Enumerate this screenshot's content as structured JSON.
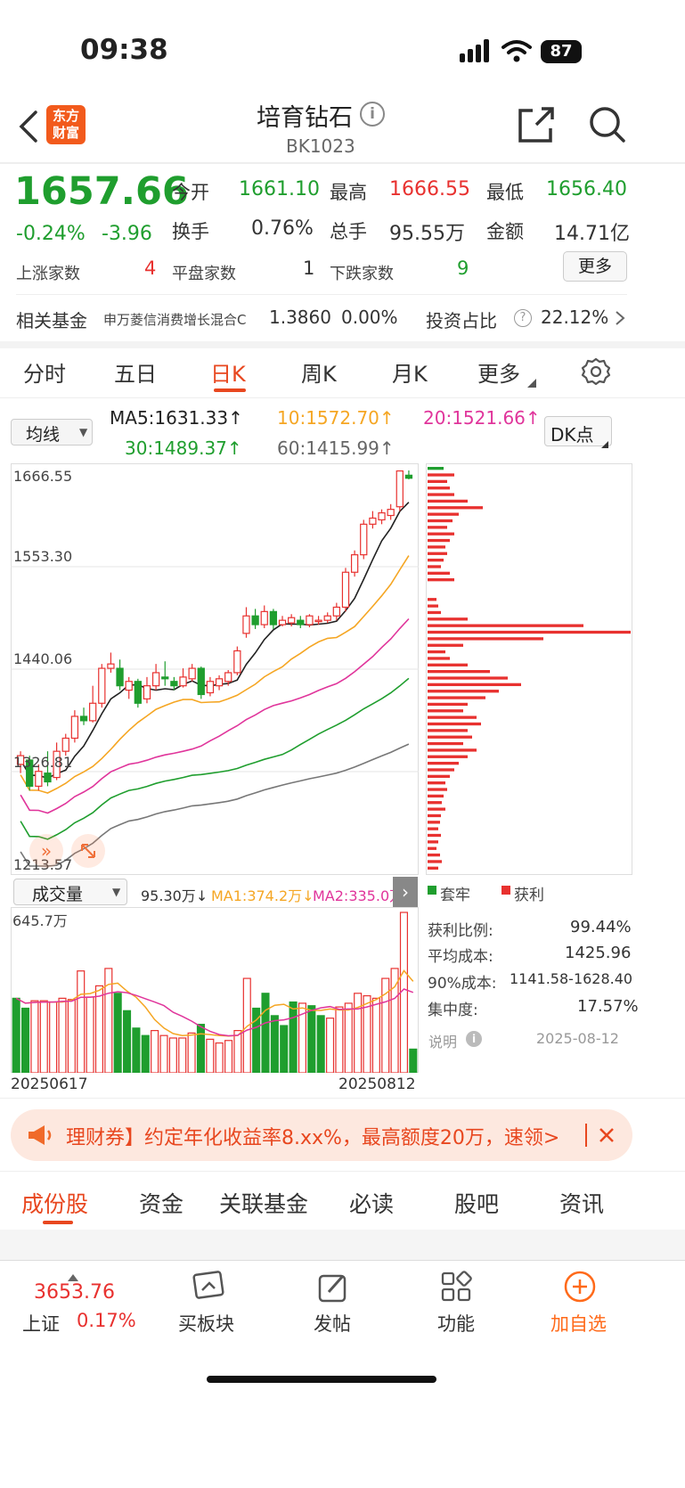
{
  "status": {
    "time": "09:38",
    "battery": "87"
  },
  "header": {
    "logo_line1": "东方",
    "logo_line2": "财富",
    "title": "培育钻石",
    "code": "BK1023"
  },
  "quote": {
    "price": "1657.66",
    "change_pct": "-0.24%",
    "change": "-3.96",
    "open_label": "今开",
    "open": "1661.10",
    "high_label": "最高",
    "high": "1666.55",
    "low_label": "最低",
    "low": "1656.40",
    "turnover_label": "换手",
    "turnover": "0.76%",
    "volume_label": "总手",
    "volume": "95.55万",
    "amount_label": "金额",
    "amount": "14.71亿",
    "up_label": "上涨家数",
    "up": "4",
    "flat_label": "平盘家数",
    "flat": "1",
    "down_label": "下跌家数",
    "down": "9",
    "more": "更多"
  },
  "fund": {
    "label": "相关基金",
    "name": "申万菱信消费增长混合C",
    "nav": "1.3860",
    "pct": "0.00%",
    "ratio_label": "投资占比",
    "ratio": "22.12%"
  },
  "tabs": [
    "分时",
    "五日",
    "日K",
    "周K",
    "月K",
    "更多"
  ],
  "ma": {
    "selector": "均线",
    "ma5": "MA5:1631.33",
    "ma10": "10:1572.70",
    "ma20": "20:1521.66",
    "ma30": "30:1489.37",
    "ma60": "60:1415.99",
    "dk": "DK点"
  },
  "axis": {
    "y1": "1666.55",
    "y2": "1553.30",
    "y3": "1440.06",
    "y4": "1326.81",
    "y5": "1213.57"
  },
  "volume_panel": {
    "selector": "成交量",
    "vol": "95.30万",
    "ma1": "MA1:374.2万",
    "ma2": "MA2:335.0万",
    "max": "645.7万",
    "date_start": "20250617",
    "date_end": "20250812"
  },
  "chip": {
    "legend_solid": "套牢",
    "legend_profit": "获利",
    "profit_ratio_label": "获利比例:",
    "profit_ratio": "99.44%",
    "avg_cost_label": "平均成本:",
    "avg_cost": "1425.96",
    "cost90_label": "90%成本:",
    "cost90": "1141.58-1628.40",
    "concentration_label": "集中度:",
    "concentration": "17.57%",
    "note_label": "说明",
    "date": "2025-08-12"
  },
  "banner": {
    "text": "理财券】约定年化收益率8.xx%，最高额度20万，速领>"
  },
  "bottom_tabs": [
    "成份股",
    "资金",
    "关联基金",
    "必读",
    "股吧",
    "资讯"
  ],
  "toolbar": {
    "index_value": "3653.76",
    "index_name": "上证",
    "index_pct": "0.17%",
    "buy": "买板块",
    "post": "发帖",
    "func": "功能",
    "add": "加自选"
  },
  "colors": {
    "up": "#e8312f",
    "down": "#1f9e2e",
    "ma5": "#222222",
    "ma10": "#f5a623",
    "ma20": "#e0359b",
    "ma30": "#1f9e2e",
    "ma60": "#777777",
    "accent": "#ff6a1a"
  },
  "chart_data": {
    "type": "candlestick",
    "y_range": [
      1213.57,
      1666.55
    ],
    "candles": [
      {
        "o": 1330,
        "c": 1340,
        "h": 1345,
        "l": 1320
      },
      {
        "o": 1335,
        "c": 1305,
        "h": 1340,
        "l": 1300
      },
      {
        "o": 1305,
        "c": 1322,
        "h": 1330,
        "l": 1300
      },
      {
        "o": 1320,
        "c": 1310,
        "h": 1345,
        "l": 1305
      },
      {
        "o": 1315,
        "c": 1345,
        "h": 1355,
        "l": 1312
      },
      {
        "o": 1345,
        "c": 1360,
        "h": 1365,
        "l": 1340
      },
      {
        "o": 1360,
        "c": 1385,
        "h": 1392,
        "l": 1355
      },
      {
        "o": 1385,
        "c": 1380,
        "h": 1395,
        "l": 1375
      },
      {
        "o": 1380,
        "c": 1400,
        "h": 1420,
        "l": 1378
      },
      {
        "o": 1400,
        "c": 1440,
        "h": 1445,
        "l": 1395
      },
      {
        "o": 1440,
        "c": 1445,
        "h": 1458,
        "l": 1435
      },
      {
        "o": 1440,
        "c": 1420,
        "h": 1450,
        "l": 1415
      },
      {
        "o": 1415,
        "c": 1425,
        "h": 1430,
        "l": 1405
      },
      {
        "o": 1425,
        "c": 1400,
        "h": 1428,
        "l": 1395
      },
      {
        "o": 1405,
        "c": 1420,
        "h": 1430,
        "l": 1400
      },
      {
        "o": 1420,
        "c": 1435,
        "h": 1445,
        "l": 1415
      },
      {
        "o": 1430,
        "c": 1428,
        "h": 1448,
        "l": 1420
      },
      {
        "o": 1425,
        "c": 1420,
        "h": 1430,
        "l": 1415
      },
      {
        "o": 1420,
        "c": 1430,
        "h": 1440,
        "l": 1418
      },
      {
        "o": 1428,
        "c": 1440,
        "h": 1445,
        "l": 1425
      },
      {
        "o": 1440,
        "c": 1410,
        "h": 1442,
        "l": 1405
      },
      {
        "o": 1412,
        "c": 1425,
        "h": 1430,
        "l": 1408
      },
      {
        "o": 1420,
        "c": 1428,
        "h": 1432,
        "l": 1415
      },
      {
        "o": 1425,
        "c": 1435,
        "h": 1438,
        "l": 1420
      },
      {
        "o": 1435,
        "c": 1460,
        "h": 1465,
        "l": 1432
      },
      {
        "o": 1480,
        "c": 1500,
        "h": 1510,
        "l": 1475
      },
      {
        "o": 1500,
        "c": 1490,
        "h": 1508,
        "l": 1485
      },
      {
        "o": 1490,
        "c": 1505,
        "h": 1512,
        "l": 1486
      },
      {
        "o": 1505,
        "c": 1490,
        "h": 1508,
        "l": 1485
      },
      {
        "o": 1490,
        "c": 1495,
        "h": 1500,
        "l": 1488
      },
      {
        "o": 1492,
        "c": 1498,
        "h": 1502,
        "l": 1488
      },
      {
        "o": 1495,
        "c": 1490,
        "h": 1500,
        "l": 1486
      },
      {
        "o": 1490,
        "c": 1500,
        "h": 1502,
        "l": 1487
      },
      {
        "o": 1495,
        "c": 1495,
        "h": 1500,
        "l": 1490
      },
      {
        "o": 1495,
        "c": 1500,
        "h": 1504,
        "l": 1492
      },
      {
        "o": 1500,
        "c": 1510,
        "h": 1515,
        "l": 1495
      },
      {
        "o": 1510,
        "c": 1550,
        "h": 1555,
        "l": 1505
      },
      {
        "o": 1550,
        "c": 1570,
        "h": 1575,
        "l": 1545
      },
      {
        "o": 1570,
        "c": 1605,
        "h": 1610,
        "l": 1565
      },
      {
        "o": 1605,
        "c": 1612,
        "h": 1620,
        "l": 1600
      },
      {
        "o": 1610,
        "c": 1618,
        "h": 1622,
        "l": 1605
      },
      {
        "o": 1615,
        "c": 1622,
        "h": 1628,
        "l": 1610
      },
      {
        "o": 1625,
        "c": 1666,
        "h": 1666.55,
        "l": 1620
      },
      {
        "o": 1661.1,
        "c": 1657.66,
        "h": 1666.55,
        "l": 1656.4
      }
    ],
    "volumes": [
      {
        "v": 300,
        "up": false
      },
      {
        "v": 260,
        "up": false
      },
      {
        "v": 290,
        "up": true
      },
      {
        "v": 290,
        "up": true
      },
      {
        "v": 285,
        "up": true
      },
      {
        "v": 300,
        "up": true
      },
      {
        "v": 295,
        "up": true
      },
      {
        "v": 410,
        "up": true
      },
      {
        "v": 305,
        "up": true
      },
      {
        "v": 350,
        "up": true
      },
      {
        "v": 420,
        "up": true
      },
      {
        "v": 320,
        "up": false
      },
      {
        "v": 250,
        "up": false
      },
      {
        "v": 180,
        "up": false
      },
      {
        "v": 150,
        "up": false
      },
      {
        "v": 170,
        "up": true
      },
      {
        "v": 150,
        "up": true
      },
      {
        "v": 140,
        "up": true
      },
      {
        "v": 140,
        "up": true
      },
      {
        "v": 160,
        "up": true
      },
      {
        "v": 195,
        "up": false
      },
      {
        "v": 135,
        "up": true
      },
      {
        "v": 120,
        "up": true
      },
      {
        "v": 130,
        "up": true
      },
      {
        "v": 170,
        "up": true
      },
      {
        "v": 380,
        "up": true
      },
      {
        "v": 260,
        "up": false
      },
      {
        "v": 320,
        "up": false
      },
      {
        "v": 230,
        "up": false
      },
      {
        "v": 190,
        "up": false
      },
      {
        "v": 285,
        "up": false
      },
      {
        "v": 280,
        "up": true
      },
      {
        "v": 270,
        "up": false
      },
      {
        "v": 230,
        "up": false
      },
      {
        "v": 220,
        "up": true
      },
      {
        "v": 265,
        "up": true
      },
      {
        "v": 280,
        "up": true
      },
      {
        "v": 320,
        "up": true
      },
      {
        "v": 310,
        "up": true
      },
      {
        "v": 300,
        "up": true
      },
      {
        "v": 380,
        "up": true
      },
      {
        "v": 420,
        "up": true
      },
      {
        "v": 645.7,
        "up": true
      },
      {
        "v": 95.3,
        "up": false
      }
    ]
  }
}
